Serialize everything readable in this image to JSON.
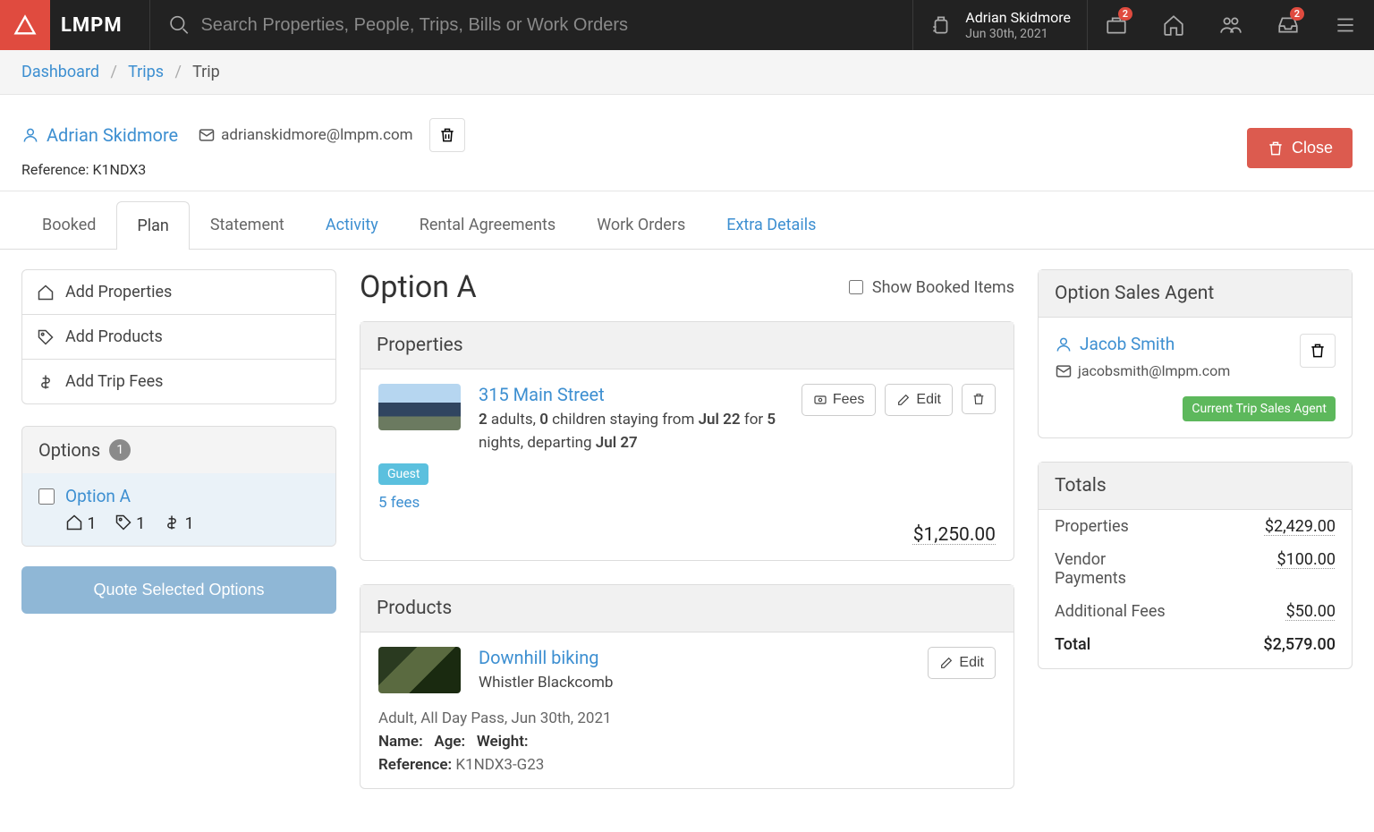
{
  "app_name": "LMPM",
  "search_placeholder": "Search Properties, People, Trips, Bills or Work Orders",
  "header_user": {
    "name": "Adrian Skidmore",
    "date": "Jun 30th, 2021"
  },
  "badges": {
    "briefcase": "2",
    "inbox": "2"
  },
  "breadcrumb": {
    "dashboard": "Dashboard",
    "trips": "Trips",
    "current": "Trip"
  },
  "guest": {
    "name": "Adrian Skidmore",
    "email": "adrianskidmore@lmpm.com",
    "reference_label": "Reference:",
    "reference": "K1NDX3"
  },
  "close_btn": "Close",
  "tabs": {
    "booked": "Booked",
    "plan": "Plan",
    "statement": "Statement",
    "activity": "Activity",
    "rental": "Rental Agreements",
    "work_orders": "Work Orders",
    "extra": "Extra Details"
  },
  "left": {
    "add_properties": "Add Properties",
    "add_products": "Add Products",
    "add_fees": "Add Trip Fees",
    "options_label": "Options",
    "options_count": "1",
    "option_a": "Option A",
    "counts": {
      "home": "1",
      "tag": "1",
      "dollar": "1"
    },
    "quote_btn": "Quote Selected Options"
  },
  "mid": {
    "title": "Option A",
    "show_booked": "Show Booked Items",
    "properties_label": "Properties",
    "property": {
      "title": "315 Main Street",
      "adults": "2",
      "adults_txt": " adults, ",
      "children": "0",
      "children_txt": " children staying from ",
      "from": "Jul 22",
      "for_txt": " for ",
      "nights": "5",
      "nights_txt": " nights, departing ",
      "to": "Jul 27",
      "guest_badge": "Guest",
      "fees_link": "5 fees",
      "price": "$1,250.00",
      "fees_btn": "Fees",
      "edit_btn": "Edit"
    },
    "products_label": "Products",
    "product": {
      "title": "Downhill biking",
      "subtitle": "Whistler Blackcomb",
      "edit_btn": "Edit",
      "meta_line": "Adult, All Day Pass, Jun 30th, 2021",
      "name_lbl": "Name:",
      "age_lbl": "Age:",
      "weight_lbl": "Weight:",
      "ref_lbl": "Reference:",
      "ref_val": "K1NDX3-G23"
    }
  },
  "right": {
    "agent_panel": "Option Sales Agent",
    "agent_name": "Jacob Smith",
    "agent_email": "jacobsmith@lmpm.com",
    "agent_badge": "Current Trip Sales Agent",
    "totals_label": "Totals",
    "rows": {
      "properties": {
        "label": "Properties",
        "amt": "$2,429.00"
      },
      "vendor": {
        "label": "Vendor Payments",
        "amt": "$100.00"
      },
      "fees": {
        "label": "Additional Fees",
        "amt": "$50.00"
      },
      "total": {
        "label": "Total",
        "amt": "$2,579.00"
      }
    }
  }
}
